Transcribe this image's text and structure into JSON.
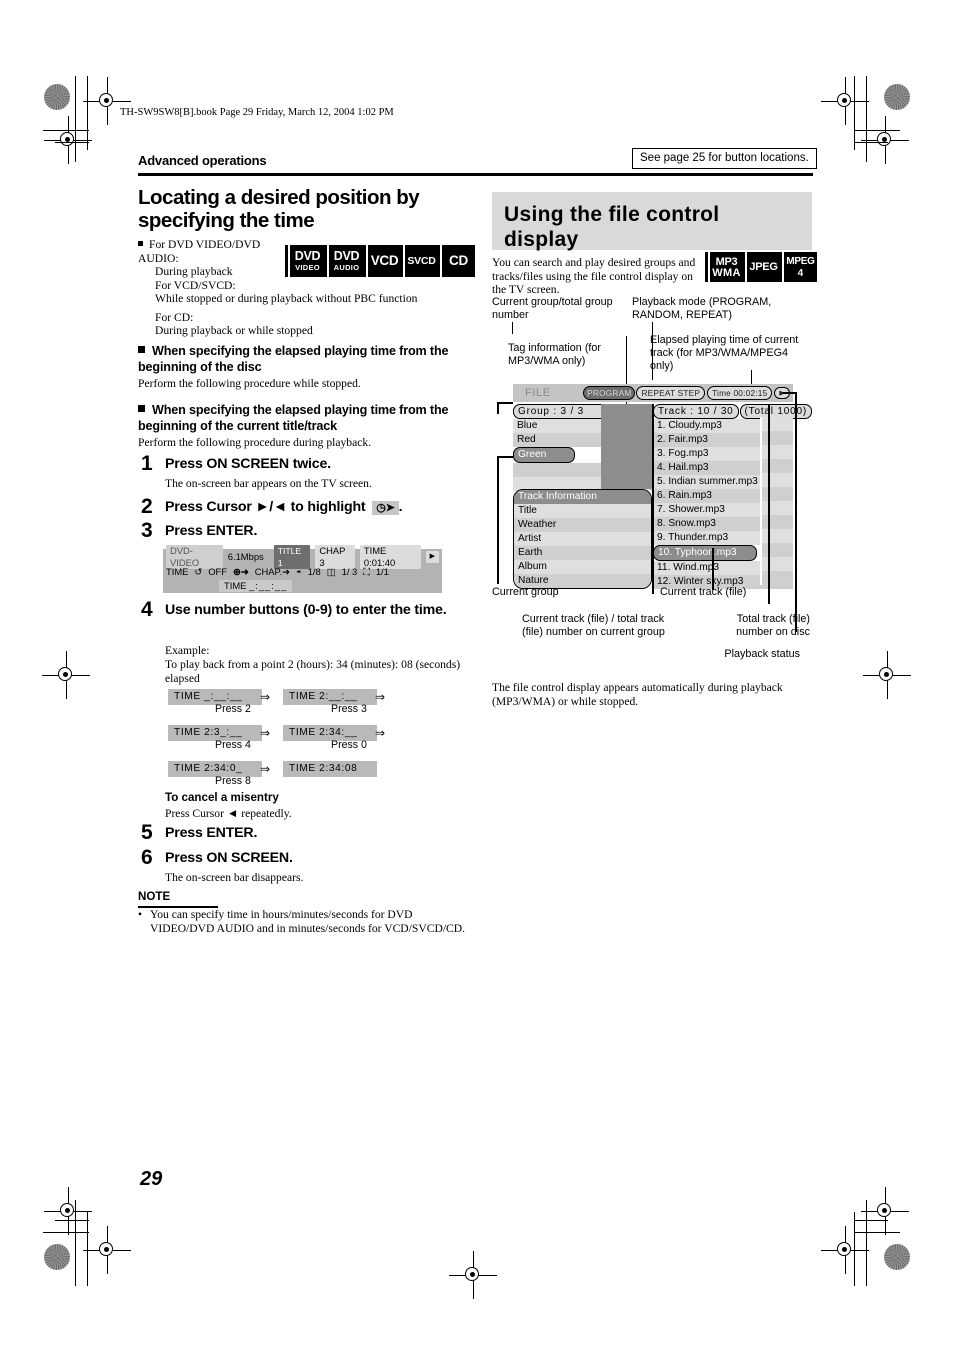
{
  "page": {
    "book_line": "TH-SW9SW8[B].book  Page 29  Friday, March 12, 2004  1:02 PM",
    "section_header": "Advanced operations",
    "see_page_note": "See page 25 for button locations.",
    "page_number": "29"
  },
  "left": {
    "title": "Locating a desired position by specifying the time",
    "applies": {
      "line1": "For DVD VIDEO/DVD AUDIO:",
      "line2": "During playback",
      "line3": "For VCD/SVCD:",
      "line4": "While stopped or during playback without PBC function",
      "line5": "For CD:",
      "line6": "During playback or while stopped"
    },
    "badges": [
      {
        "l1": "DVD",
        "l2": "VIDEO"
      },
      {
        "l1": "DVD",
        "l2": "AUDIO"
      },
      {
        "l1": "VCD",
        "l2": ""
      },
      {
        "l1": "SVCD",
        "l2": ""
      },
      {
        "l1": "CD",
        "l2": ""
      }
    ],
    "sub1": {
      "heading": "When specifying the elapsed playing time from the beginning of the disc",
      "text": "Perform the following procedure while stopped."
    },
    "sub2": {
      "heading": "When specifying the elapsed playing time from the beginning of the current title/track",
      "text": "Perform the following procedure during playback."
    },
    "steps": [
      {
        "num": "1",
        "title": "Press ON SCREEN twice.",
        "sub": "The on-screen bar appears on the TV screen."
      },
      {
        "num": "2",
        "title": "Press Cursor ►/◄ to highlight",
        "sub": ""
      },
      {
        "num": "3",
        "title": "Press ENTER.",
        "sub": ""
      },
      {
        "num": "4",
        "title": "Use number buttons (0-9) to enter the time.",
        "sub": ""
      },
      {
        "num": "5",
        "title": "Press ENTER.",
        "sub": ""
      },
      {
        "num": "6",
        "title": "Press ON SCREEN.",
        "sub": "The on-screen bar disappears."
      }
    ],
    "osd_bar": {
      "disc_label": "DVD-VIDEO",
      "bitrate": "6.1Mbps",
      "title_chip": "TITLE 1",
      "chap_chip": "CHAP 3",
      "time_chip": "TIME  0:01:40",
      "arrow_chip": "▶",
      "row2_time": "TIME",
      "row2_repeat": "OFF",
      "row2_clock": "⊕➜",
      "row2_chap": "CHAP.➜",
      "row2_audio": "1/8",
      "row2_subtitle": "1/ 3",
      "row2_angle": "1/1",
      "row3_label": "TIME",
      "row3_value": "_:__:__"
    },
    "example": {
      "label": "Example:",
      "text": "To play back from a point 2 (hours): 34 (minutes): 08 (seconds) elapsed",
      "entries": [
        {
          "chip": "TIME  _:__:__",
          "press": ""
        },
        {
          "chip": "TIME  2:__:__",
          "press": "Press 2"
        },
        {
          "chip": "TIME  2:3_:__",
          "press": "Press 3"
        },
        {
          "chip": "TIME  2:34:__",
          "press": "Press 4"
        },
        {
          "chip": "TIME  2:34:0_",
          "press": "Press 0"
        },
        {
          "chip": "TIME  2:34:08",
          "press": "Press 8"
        }
      ],
      "arrow": "⇒"
    },
    "cancel": {
      "heading": "To cancel a misentry",
      "text": "Press Cursor ◄ repeatedly."
    },
    "note": {
      "label": "NOTE",
      "bullet": "You can specify time in hours/minutes/seconds for DVD VIDEO/DVD AUDIO and in minutes/seconds for VCD/SVCD/CD."
    }
  },
  "right": {
    "title": "Using the file control display",
    "intro": "You can search and play desired groups and tracks/files using the file control display on the TV screen.",
    "badges": [
      {
        "l1": "MP3",
        "l2": "WMA"
      },
      {
        "l1": "JPEG",
        "l2": ""
      },
      {
        "l1": "MPEG",
        "l2": "4"
      }
    ],
    "callouts": {
      "current_group_total": "Current group/total group number",
      "playback_mode": "Playback mode (PROGRAM, RANDOM, REPEAT)",
      "tag_information": "Tag information (for MP3/WMA only)",
      "elapsed_time": "Elapsed playing time of current track (for MP3/WMA/MPEG4 only)",
      "current_group": "Current group",
      "current_track_file": "Current track (file)",
      "current_total_on_group": "Current track (file) / total track (file) number on current group",
      "total_on_disc": "Total track (file) number on disc",
      "playback_status": "Playback status"
    },
    "display": {
      "file_label": "FILE",
      "pill_program": "PROGRAM",
      "pill_repeat": "REPEAT STEP",
      "pill_time": "Time 00:02:15",
      "pill_play": "▶",
      "group_header": "Group :  3 / 3",
      "track_header": "Track : 10 / 30",
      "total_header": "(Total  1000)",
      "groups": [
        "Blue",
        "Red",
        "Green",
        "",
        ""
      ],
      "selected_group": "Green",
      "track_info_header": "Track  Information",
      "track_info": [
        "Title",
        "Weather",
        "Artist",
        "Earth",
        "Album",
        "Nature"
      ],
      "tracks": [
        "1. Cloudy.mp3",
        "2. Fair.mp3",
        "3. Fog.mp3",
        "4. Hail.mp3",
        "5. Indian summer.mp3",
        "6. Rain.mp3",
        "7. Shower.mp3",
        "8. Snow.mp3",
        "9. Thunder.mp3",
        "10. Typhoon.mp3",
        "11. Wind.mp3",
        "12. Winter sky.mp3"
      ],
      "selected_track": "10. Typhoon.mp3"
    },
    "outro": "The file control display appears automatically during playback (MP3/WMA) or while stopped."
  }
}
